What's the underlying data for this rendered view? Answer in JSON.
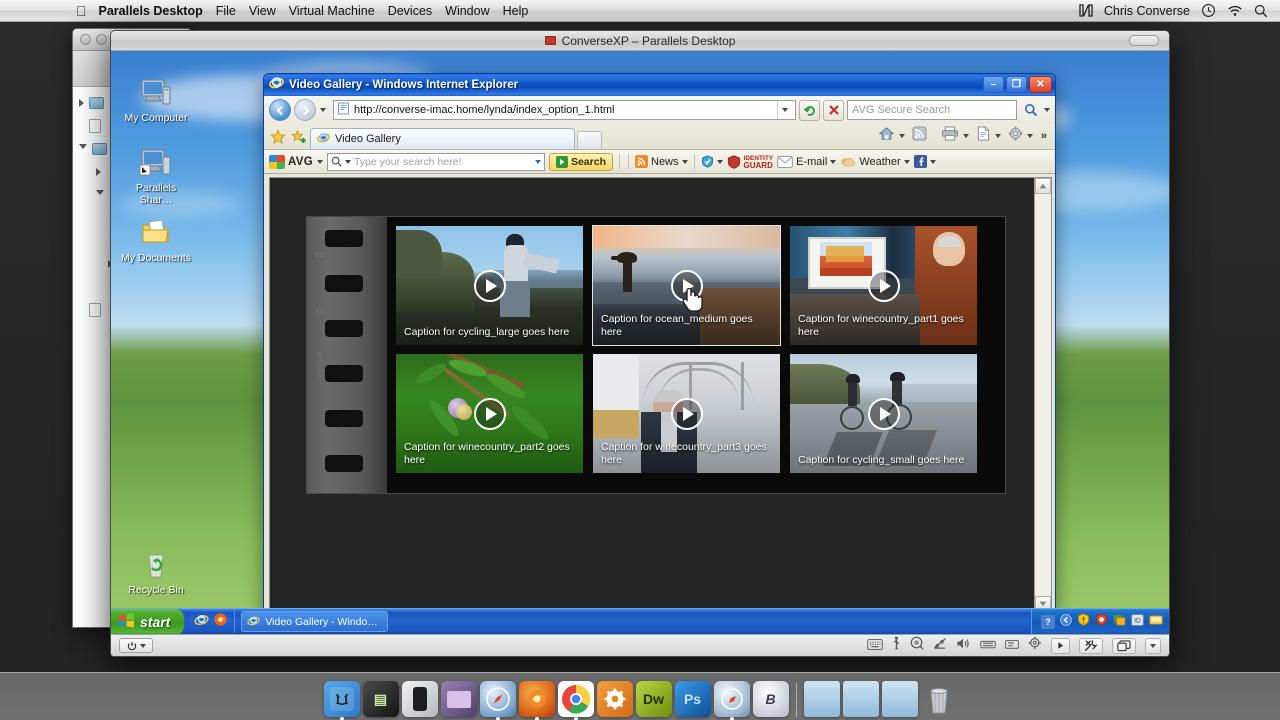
{
  "mac_menubar": {
    "apple_icon": "apple-icon",
    "items": [
      "Parallels Desktop",
      "File",
      "View",
      "Virtual Machine",
      "Devices",
      "Window",
      "Help"
    ],
    "right": {
      "app_icon": "monitor-icon",
      "user": "Chris Converse",
      "icons": [
        "time-machine-icon",
        "wifi-icon",
        "spotlight-search-icon"
      ]
    }
  },
  "vm_window": {
    "title": "ConverseXP – Parallels Desktop",
    "icon": "parallels-screen-icon"
  },
  "xp_desktop": {
    "icons": [
      {
        "label": "My Computer",
        "icon": "my-computer-icon"
      },
      {
        "label": "Parallels Shar…",
        "icon": "parallels-shared-folder-icon"
      },
      {
        "label": "My Documents",
        "icon": "my-documents-icon"
      },
      {
        "label": "Recycle Bin",
        "icon": "recycle-bin-icon"
      }
    ]
  },
  "ie_window": {
    "title": "Video Gallery - Windows Internet Explorer",
    "icon": "internet-explorer-icon",
    "window_buttons": {
      "minimize": "–",
      "maximize": "❐",
      "close": "✕"
    },
    "address": {
      "url": "http://converse-imac.home/lynda/index_option_1.html",
      "page_icon": "page-icon",
      "dropdown": "chevron-down-icon",
      "refresh": "refresh-icon",
      "stop": "stop-icon"
    },
    "search": {
      "placeholder": "AVG Secure Search",
      "icon": "magnifier-icon",
      "dropdown": "chevron-down-icon"
    },
    "tabs": {
      "favorites_icon": "favorites-star-icon",
      "add_favorite_icon": "add-favorite-icon",
      "items": [
        {
          "label": "Video Gallery",
          "icon": "internet-explorer-icon"
        }
      ],
      "new_tab": "new-tab-button",
      "toolbar_icons": [
        "home-icon",
        "rss-feed-icon",
        "print-icon",
        "page-icon",
        "tools-gear-icon"
      ],
      "overflow": "»"
    },
    "avg_toolbar": {
      "brand": "AVG",
      "search_placeholder": "Type your search here!",
      "search_button": "Search",
      "items": [
        {
          "label": "News",
          "icon": "rss-icon"
        },
        {
          "label": "",
          "icon": "avg-shield-icon"
        },
        {
          "label": "IDENTITY GUARD",
          "icon": "identity-guard-icon"
        },
        {
          "label": "E-mail",
          "icon": "envelope-icon"
        },
        {
          "label": "Weather",
          "icon": "weather-cloud-icon"
        },
        {
          "label": "",
          "icon": "facebook-icon"
        }
      ]
    },
    "scrollbar": {
      "up": "▲",
      "down": "▼"
    }
  },
  "gallery": {
    "thumbnails": [
      {
        "caption": "Caption for cycling_large goes here",
        "id": "cycling_large",
        "active": false,
        "play": "play-icon"
      },
      {
        "caption": "Caption for ocean_medium goes here",
        "id": "ocean_medium",
        "active": true,
        "play": "play-icon"
      },
      {
        "caption": "Caption for winecountry_part1 goes here",
        "id": "winecountry_part1",
        "active": false,
        "play": "play-icon"
      },
      {
        "caption": "Caption for winecountry_part2 goes here",
        "id": "winecountry_part2",
        "active": false,
        "play": "play-icon"
      },
      {
        "caption": "Caption for winecountry_part3 goes here",
        "id": "winecountry_part3",
        "active": false,
        "play": "play-icon"
      },
      {
        "caption": "Caption for cycling_small goes here",
        "id": "cycling_small",
        "active": false,
        "play": "play-icon"
      }
    ],
    "cursor": "hand-pointer-cursor"
  },
  "xp_taskbar": {
    "start_label": "start",
    "start_icon": "windows-flag-icon",
    "quicklaunch": [
      "internet-explorer-icon",
      "firefox-icon"
    ],
    "tasks": [
      {
        "label": "Video Gallery - Windo…",
        "icon": "internet-explorer-icon"
      }
    ],
    "tray_icons": [
      "help-icon",
      "hide-arrow-icon",
      "shield-warning-icon",
      "avg-icon",
      "update-icon",
      "display-icon",
      "network-icon"
    ]
  },
  "vm_statusbar": {
    "power_icon": "power-icon",
    "icons": [
      "keyboard-icon",
      "usb-icon",
      "optical-disc-icon",
      "network-icon",
      "sound-icon",
      "floppy-icon",
      "clipboard-icon",
      "gear-icon",
      "play-icon",
      "tools-icon",
      "displays-icon",
      "chevron-down-icon"
    ]
  },
  "mac_dock": {
    "items": [
      {
        "name": "finder",
        "label": "",
        "color1": "#56a8e8",
        "color2": "#2e7ac4",
        "glyph": "☺",
        "running": true
      },
      {
        "name": "terminal",
        "label": "",
        "color1": "#3c3c3c",
        "color2": "#1a1a1a",
        "glyph": "▤",
        "running": false
      },
      {
        "name": "ipod",
        "label": "",
        "color1": "#f0f0f0",
        "color2": "#b8bcc2",
        "glyph": "▯",
        "running": false
      },
      {
        "name": "imovie",
        "label": "",
        "color1": "#8a6fa8",
        "color2": "#5c4a78",
        "glyph": "▣",
        "running": false
      },
      {
        "name": "safari",
        "label": "",
        "color1": "#cfe0f0",
        "color2": "#7aa4cc",
        "glyph": "✦",
        "running": true
      },
      {
        "name": "firefox",
        "label": "",
        "color1": "#f08a2a",
        "color2": "#d05510",
        "glyph": "◉",
        "running": true
      },
      {
        "name": "chrome",
        "label": "",
        "color1": "#e8453c",
        "color2": "#3aa757",
        "glyph": "◎",
        "running": true
      },
      {
        "name": "system-preferences",
        "label": "",
        "color1": "#f08c30",
        "color2": "#d06a14",
        "glyph": "✹",
        "running": false
      },
      {
        "name": "dreamweaver",
        "label": "Dw",
        "color1": "#a8c832",
        "color2": "#6f8c10",
        "glyph": "",
        "running": false
      },
      {
        "name": "photoshop",
        "label": "Ps",
        "color1": "#2a8ad8",
        "color2": "#0d4f92",
        "glyph": "",
        "running": false
      },
      {
        "name": "other-browser",
        "label": "",
        "color1": "#e8eef4",
        "color2": "#9ab4cc",
        "glyph": "◍",
        "running": true
      },
      {
        "name": "bbedit",
        "label": "B",
        "color1": "#e8e8f0",
        "color2": "#a8a8c0",
        "glyph": "",
        "running": false
      },
      {
        "name": "folder-1",
        "label": "",
        "color1": "#bcd8ee",
        "color2": "#8fbadc",
        "glyph": "",
        "running": false
      },
      {
        "name": "folder-2",
        "label": "",
        "color1": "#bcd8ee",
        "color2": "#8fbadc",
        "glyph": "",
        "running": false
      },
      {
        "name": "folder-3",
        "label": "",
        "color1": "#bcd8ee",
        "color2": "#8fbadc",
        "glyph": "",
        "running": false
      },
      {
        "name": "trash",
        "label": "",
        "color1": "#d8dce0",
        "color2": "#9aa0a6",
        "glyph": "🗑",
        "running": false
      }
    ]
  }
}
